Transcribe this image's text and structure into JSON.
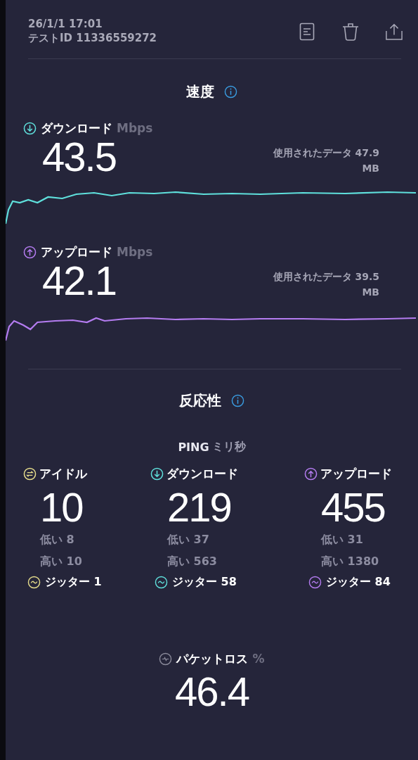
{
  "header": {
    "timestamp": "26/1/1 17:01",
    "test_id": "テストID 11336559272"
  },
  "speed": {
    "title": "速度",
    "sections": [
      {
        "kind": "download",
        "label": "ダウンロード",
        "unit": "Mbps",
        "value": "43.5",
        "data_used": "使用されたデータ 47.9 MB"
      },
      {
        "kind": "upload",
        "label": "アップロード",
        "unit": "Mbps",
        "value": "42.1",
        "data_used": "使用されたデータ 39.5 MB"
      }
    ]
  },
  "responsiveness": {
    "title": "反応性",
    "ping_label": "PING",
    "ping_unit": "ミリ秒",
    "columns": [
      {
        "kind": "idle",
        "label": "アイドル",
        "value": "10",
        "low": "低い 8",
        "high": "高い 10",
        "jitter": "ジッター 1"
      },
      {
        "kind": "download",
        "label": "ダウンロード",
        "value": "219",
        "low": "低い 37",
        "high": "高い 563",
        "jitter": "ジッター 58"
      },
      {
        "kind": "upload",
        "label": "アップロード",
        "value": "455",
        "low": "低い 31",
        "high": "高い 1380",
        "jitter": "ジッター 84"
      }
    ]
  },
  "packet_loss": {
    "label": "パケットロス",
    "unit": "%",
    "value": "46.4"
  }
}
